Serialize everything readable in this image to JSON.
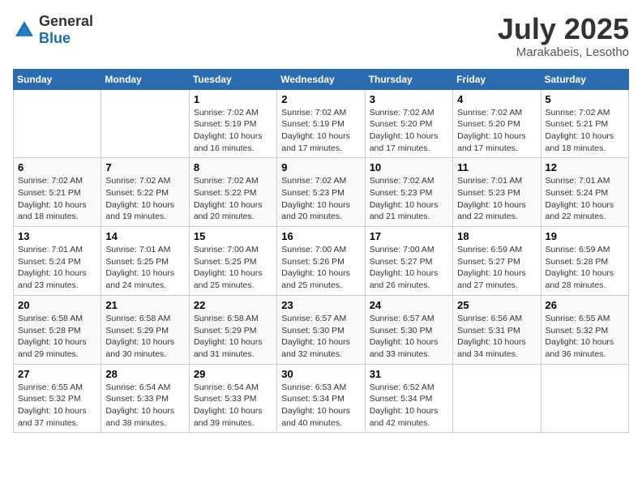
{
  "header": {
    "logo_general": "General",
    "logo_blue": "Blue",
    "title": "July 2025",
    "location": "Marakabeis, Lesotho"
  },
  "days_of_week": [
    "Sunday",
    "Monday",
    "Tuesday",
    "Wednesday",
    "Thursday",
    "Friday",
    "Saturday"
  ],
  "weeks": [
    [
      {
        "day": "",
        "detail": ""
      },
      {
        "day": "",
        "detail": ""
      },
      {
        "day": "1",
        "detail": "Sunrise: 7:02 AM\nSunset: 5:19 PM\nDaylight: 10 hours and 16 minutes."
      },
      {
        "day": "2",
        "detail": "Sunrise: 7:02 AM\nSunset: 5:19 PM\nDaylight: 10 hours and 17 minutes."
      },
      {
        "day": "3",
        "detail": "Sunrise: 7:02 AM\nSunset: 5:20 PM\nDaylight: 10 hours and 17 minutes."
      },
      {
        "day": "4",
        "detail": "Sunrise: 7:02 AM\nSunset: 5:20 PM\nDaylight: 10 hours and 17 minutes."
      },
      {
        "day": "5",
        "detail": "Sunrise: 7:02 AM\nSunset: 5:21 PM\nDaylight: 10 hours and 18 minutes."
      }
    ],
    [
      {
        "day": "6",
        "detail": "Sunrise: 7:02 AM\nSunset: 5:21 PM\nDaylight: 10 hours and 18 minutes."
      },
      {
        "day": "7",
        "detail": "Sunrise: 7:02 AM\nSunset: 5:22 PM\nDaylight: 10 hours and 19 minutes."
      },
      {
        "day": "8",
        "detail": "Sunrise: 7:02 AM\nSunset: 5:22 PM\nDaylight: 10 hours and 20 minutes."
      },
      {
        "day": "9",
        "detail": "Sunrise: 7:02 AM\nSunset: 5:23 PM\nDaylight: 10 hours and 20 minutes."
      },
      {
        "day": "10",
        "detail": "Sunrise: 7:02 AM\nSunset: 5:23 PM\nDaylight: 10 hours and 21 minutes."
      },
      {
        "day": "11",
        "detail": "Sunrise: 7:01 AM\nSunset: 5:23 PM\nDaylight: 10 hours and 22 minutes."
      },
      {
        "day": "12",
        "detail": "Sunrise: 7:01 AM\nSunset: 5:24 PM\nDaylight: 10 hours and 22 minutes."
      }
    ],
    [
      {
        "day": "13",
        "detail": "Sunrise: 7:01 AM\nSunset: 5:24 PM\nDaylight: 10 hours and 23 minutes."
      },
      {
        "day": "14",
        "detail": "Sunrise: 7:01 AM\nSunset: 5:25 PM\nDaylight: 10 hours and 24 minutes."
      },
      {
        "day": "15",
        "detail": "Sunrise: 7:00 AM\nSunset: 5:25 PM\nDaylight: 10 hours and 25 minutes."
      },
      {
        "day": "16",
        "detail": "Sunrise: 7:00 AM\nSunset: 5:26 PM\nDaylight: 10 hours and 25 minutes."
      },
      {
        "day": "17",
        "detail": "Sunrise: 7:00 AM\nSunset: 5:27 PM\nDaylight: 10 hours and 26 minutes."
      },
      {
        "day": "18",
        "detail": "Sunrise: 6:59 AM\nSunset: 5:27 PM\nDaylight: 10 hours and 27 minutes."
      },
      {
        "day": "19",
        "detail": "Sunrise: 6:59 AM\nSunset: 5:28 PM\nDaylight: 10 hours and 28 minutes."
      }
    ],
    [
      {
        "day": "20",
        "detail": "Sunrise: 6:58 AM\nSunset: 5:28 PM\nDaylight: 10 hours and 29 minutes."
      },
      {
        "day": "21",
        "detail": "Sunrise: 6:58 AM\nSunset: 5:29 PM\nDaylight: 10 hours and 30 minutes."
      },
      {
        "day": "22",
        "detail": "Sunrise: 6:58 AM\nSunset: 5:29 PM\nDaylight: 10 hours and 31 minutes."
      },
      {
        "day": "23",
        "detail": "Sunrise: 6:57 AM\nSunset: 5:30 PM\nDaylight: 10 hours and 32 minutes."
      },
      {
        "day": "24",
        "detail": "Sunrise: 6:57 AM\nSunset: 5:30 PM\nDaylight: 10 hours and 33 minutes."
      },
      {
        "day": "25",
        "detail": "Sunrise: 6:56 AM\nSunset: 5:31 PM\nDaylight: 10 hours and 34 minutes."
      },
      {
        "day": "26",
        "detail": "Sunrise: 6:55 AM\nSunset: 5:32 PM\nDaylight: 10 hours and 36 minutes."
      }
    ],
    [
      {
        "day": "27",
        "detail": "Sunrise: 6:55 AM\nSunset: 5:32 PM\nDaylight: 10 hours and 37 minutes."
      },
      {
        "day": "28",
        "detail": "Sunrise: 6:54 AM\nSunset: 5:33 PM\nDaylight: 10 hours and 38 minutes."
      },
      {
        "day": "29",
        "detail": "Sunrise: 6:54 AM\nSunset: 5:33 PM\nDaylight: 10 hours and 39 minutes."
      },
      {
        "day": "30",
        "detail": "Sunrise: 6:53 AM\nSunset: 5:34 PM\nDaylight: 10 hours and 40 minutes."
      },
      {
        "day": "31",
        "detail": "Sunrise: 6:52 AM\nSunset: 5:34 PM\nDaylight: 10 hours and 42 minutes."
      },
      {
        "day": "",
        "detail": ""
      },
      {
        "day": "",
        "detail": ""
      }
    ]
  ]
}
